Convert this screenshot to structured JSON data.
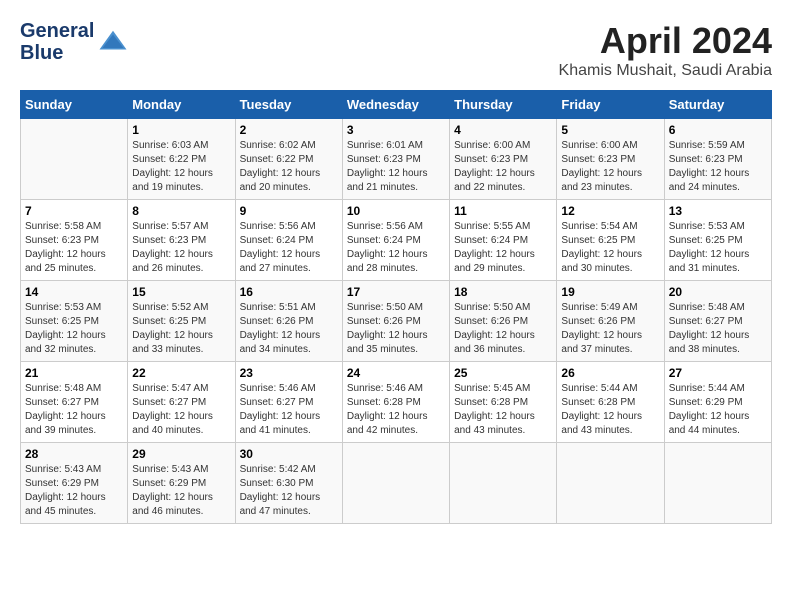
{
  "header": {
    "logo_line1": "General",
    "logo_line2": "Blue",
    "month_year": "April 2024",
    "location": "Khamis Mushait, Saudi Arabia"
  },
  "columns": [
    "Sunday",
    "Monday",
    "Tuesday",
    "Wednesday",
    "Thursday",
    "Friday",
    "Saturday"
  ],
  "weeks": [
    [
      {
        "day": "",
        "sunrise": "",
        "sunset": "",
        "daylight": ""
      },
      {
        "day": "1",
        "sunrise": "Sunrise: 6:03 AM",
        "sunset": "Sunset: 6:22 PM",
        "daylight": "Daylight: 12 hours and 19 minutes."
      },
      {
        "day": "2",
        "sunrise": "Sunrise: 6:02 AM",
        "sunset": "Sunset: 6:22 PM",
        "daylight": "Daylight: 12 hours and 20 minutes."
      },
      {
        "day": "3",
        "sunrise": "Sunrise: 6:01 AM",
        "sunset": "Sunset: 6:23 PM",
        "daylight": "Daylight: 12 hours and 21 minutes."
      },
      {
        "day": "4",
        "sunrise": "Sunrise: 6:00 AM",
        "sunset": "Sunset: 6:23 PM",
        "daylight": "Daylight: 12 hours and 22 minutes."
      },
      {
        "day": "5",
        "sunrise": "Sunrise: 6:00 AM",
        "sunset": "Sunset: 6:23 PM",
        "daylight": "Daylight: 12 hours and 23 minutes."
      },
      {
        "day": "6",
        "sunrise": "Sunrise: 5:59 AM",
        "sunset": "Sunset: 6:23 PM",
        "daylight": "Daylight: 12 hours and 24 minutes."
      }
    ],
    [
      {
        "day": "7",
        "sunrise": "Sunrise: 5:58 AM",
        "sunset": "Sunset: 6:23 PM",
        "daylight": "Daylight: 12 hours and 25 minutes."
      },
      {
        "day": "8",
        "sunrise": "Sunrise: 5:57 AM",
        "sunset": "Sunset: 6:23 PM",
        "daylight": "Daylight: 12 hours and 26 minutes."
      },
      {
        "day": "9",
        "sunrise": "Sunrise: 5:56 AM",
        "sunset": "Sunset: 6:24 PM",
        "daylight": "Daylight: 12 hours and 27 minutes."
      },
      {
        "day": "10",
        "sunrise": "Sunrise: 5:56 AM",
        "sunset": "Sunset: 6:24 PM",
        "daylight": "Daylight: 12 hours and 28 minutes."
      },
      {
        "day": "11",
        "sunrise": "Sunrise: 5:55 AM",
        "sunset": "Sunset: 6:24 PM",
        "daylight": "Daylight: 12 hours and 29 minutes."
      },
      {
        "day": "12",
        "sunrise": "Sunrise: 5:54 AM",
        "sunset": "Sunset: 6:25 PM",
        "daylight": "Daylight: 12 hours and 30 minutes."
      },
      {
        "day": "13",
        "sunrise": "Sunrise: 5:53 AM",
        "sunset": "Sunset: 6:25 PM",
        "daylight": "Daylight: 12 hours and 31 minutes."
      }
    ],
    [
      {
        "day": "14",
        "sunrise": "Sunrise: 5:53 AM",
        "sunset": "Sunset: 6:25 PM",
        "daylight": "Daylight: 12 hours and 32 minutes."
      },
      {
        "day": "15",
        "sunrise": "Sunrise: 5:52 AM",
        "sunset": "Sunset: 6:25 PM",
        "daylight": "Daylight: 12 hours and 33 minutes."
      },
      {
        "day": "16",
        "sunrise": "Sunrise: 5:51 AM",
        "sunset": "Sunset: 6:26 PM",
        "daylight": "Daylight: 12 hours and 34 minutes."
      },
      {
        "day": "17",
        "sunrise": "Sunrise: 5:50 AM",
        "sunset": "Sunset: 6:26 PM",
        "daylight": "Daylight: 12 hours and 35 minutes."
      },
      {
        "day": "18",
        "sunrise": "Sunrise: 5:50 AM",
        "sunset": "Sunset: 6:26 PM",
        "daylight": "Daylight: 12 hours and 36 minutes."
      },
      {
        "day": "19",
        "sunrise": "Sunrise: 5:49 AM",
        "sunset": "Sunset: 6:26 PM",
        "daylight": "Daylight: 12 hours and 37 minutes."
      },
      {
        "day": "20",
        "sunrise": "Sunrise: 5:48 AM",
        "sunset": "Sunset: 6:27 PM",
        "daylight": "Daylight: 12 hours and 38 minutes."
      }
    ],
    [
      {
        "day": "21",
        "sunrise": "Sunrise: 5:48 AM",
        "sunset": "Sunset: 6:27 PM",
        "daylight": "Daylight: 12 hours and 39 minutes."
      },
      {
        "day": "22",
        "sunrise": "Sunrise: 5:47 AM",
        "sunset": "Sunset: 6:27 PM",
        "daylight": "Daylight: 12 hours and 40 minutes."
      },
      {
        "day": "23",
        "sunrise": "Sunrise: 5:46 AM",
        "sunset": "Sunset: 6:27 PM",
        "daylight": "Daylight: 12 hours and 41 minutes."
      },
      {
        "day": "24",
        "sunrise": "Sunrise: 5:46 AM",
        "sunset": "Sunset: 6:28 PM",
        "daylight": "Daylight: 12 hours and 42 minutes."
      },
      {
        "day": "25",
        "sunrise": "Sunrise: 5:45 AM",
        "sunset": "Sunset: 6:28 PM",
        "daylight": "Daylight: 12 hours and 43 minutes."
      },
      {
        "day": "26",
        "sunrise": "Sunrise: 5:44 AM",
        "sunset": "Sunset: 6:28 PM",
        "daylight": "Daylight: 12 hours and 43 minutes."
      },
      {
        "day": "27",
        "sunrise": "Sunrise: 5:44 AM",
        "sunset": "Sunset: 6:29 PM",
        "daylight": "Daylight: 12 hours and 44 minutes."
      }
    ],
    [
      {
        "day": "28",
        "sunrise": "Sunrise: 5:43 AM",
        "sunset": "Sunset: 6:29 PM",
        "daylight": "Daylight: 12 hours and 45 minutes."
      },
      {
        "day": "29",
        "sunrise": "Sunrise: 5:43 AM",
        "sunset": "Sunset: 6:29 PM",
        "daylight": "Daylight: 12 hours and 46 minutes."
      },
      {
        "day": "30",
        "sunrise": "Sunrise: 5:42 AM",
        "sunset": "Sunset: 6:30 PM",
        "daylight": "Daylight: 12 hours and 47 minutes."
      },
      {
        "day": "",
        "sunrise": "",
        "sunset": "",
        "daylight": ""
      },
      {
        "day": "",
        "sunrise": "",
        "sunset": "",
        "daylight": ""
      },
      {
        "day": "",
        "sunrise": "",
        "sunset": "",
        "daylight": ""
      },
      {
        "day": "",
        "sunrise": "",
        "sunset": "",
        "daylight": ""
      }
    ]
  ]
}
